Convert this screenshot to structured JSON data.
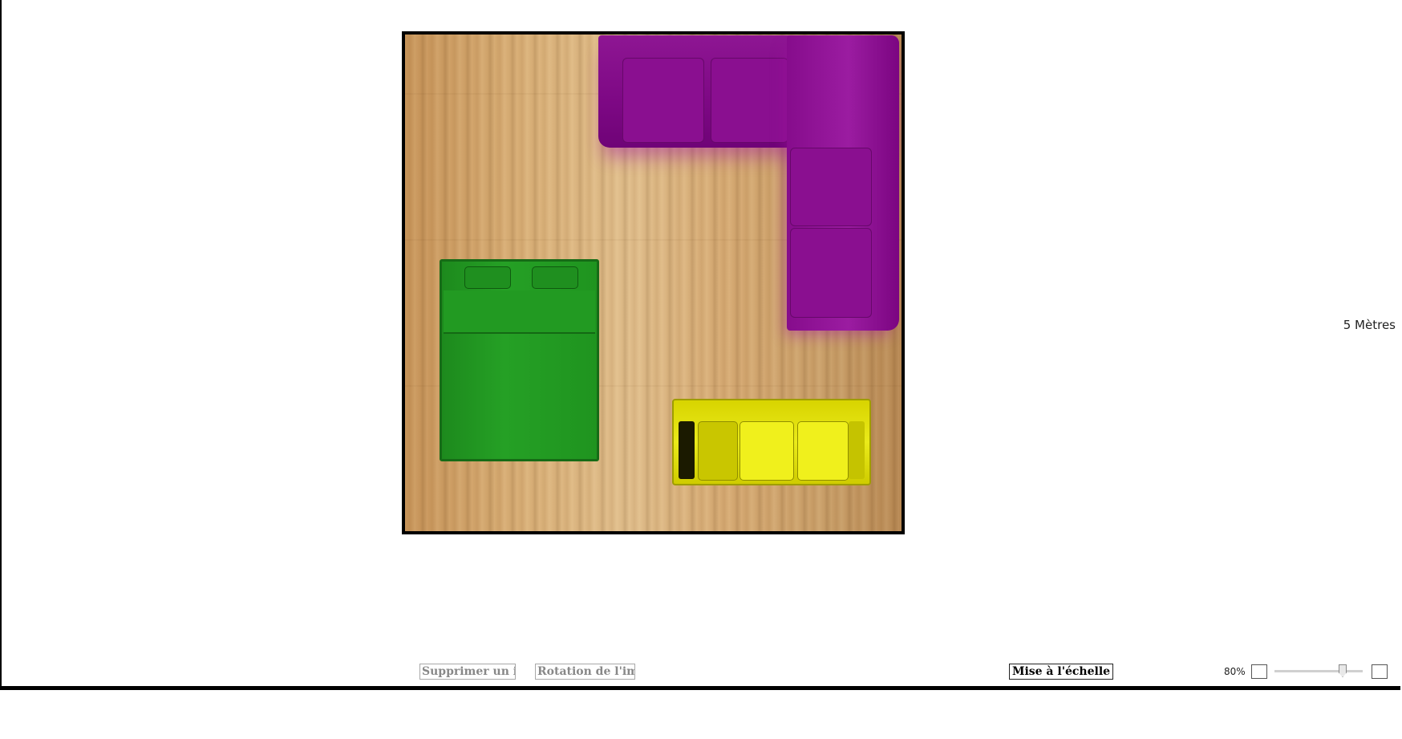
{
  "canvas": {
    "scale_label": "5 Mètres",
    "items": [
      {
        "name": "corner-sofa",
        "color": "#800a87"
      },
      {
        "name": "double-bed",
        "color": "#1f961f"
      },
      {
        "name": "three-seat-sofa",
        "color": "#e6e600"
      }
    ]
  },
  "toolbar": {
    "delete_label": "Supprimer un item",
    "rotate_label": "Rotation de l'image",
    "scale_label": "Mise à l'échelle"
  },
  "zoom": {
    "percent_label": "80%",
    "value": 0.8
  },
  "colors": {
    "frame": "#000000",
    "disabled_text": "#888888"
  }
}
